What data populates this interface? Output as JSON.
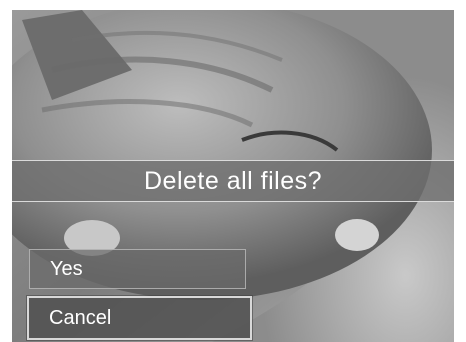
{
  "dialog": {
    "prompt": "Delete all files?"
  },
  "menu": {
    "items": [
      {
        "label": "Yes",
        "selected": false
      },
      {
        "label": "Cancel",
        "selected": true
      }
    ]
  },
  "colors": {
    "bar": "#6e6e6e",
    "text": "#ffffff",
    "highlight_border": "#d8d8d8"
  }
}
